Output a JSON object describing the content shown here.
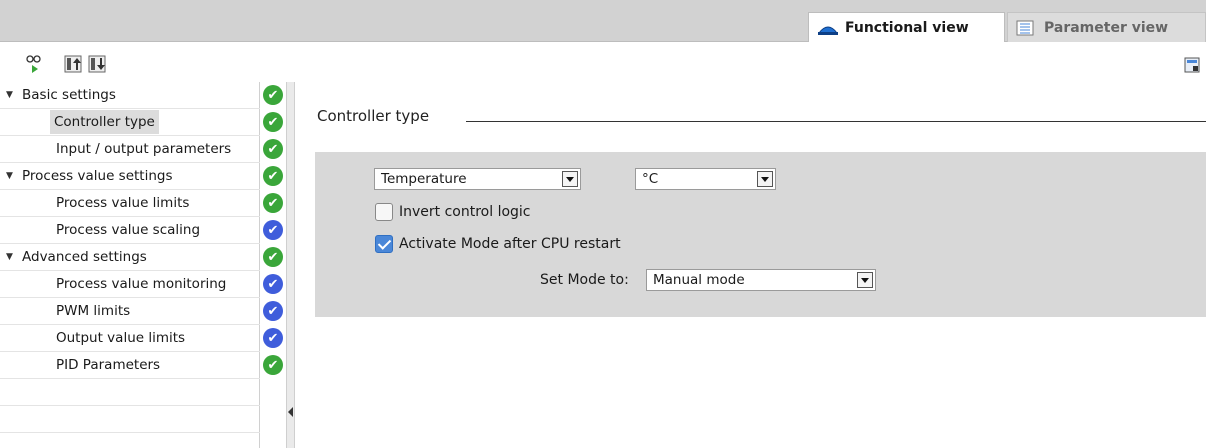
{
  "tabs": {
    "functional_view": "Functional view",
    "parameter_view": "Parameter view"
  },
  "toolbar": {
    "icons": [
      "browse-icon",
      "collapse-icon",
      "expand-icon",
      "panel-layout-icon"
    ]
  },
  "tree": {
    "items": [
      {
        "label": "Basic settings",
        "group": true,
        "status": "ok"
      },
      {
        "label": "Controller type",
        "group": false,
        "status": "ok",
        "selected": true
      },
      {
        "label": "Input / output parameters",
        "group": false,
        "status": "ok"
      },
      {
        "label": "Process value settings",
        "group": true,
        "status": "ok"
      },
      {
        "label": "Process value limits",
        "group": false,
        "status": "ok"
      },
      {
        "label": "Process value scaling",
        "group": false,
        "status": "default"
      },
      {
        "label": "Advanced settings",
        "group": true,
        "status": "ok"
      },
      {
        "label": "Process value monitoring",
        "group": false,
        "status": "default"
      },
      {
        "label": "PWM limits",
        "group": false,
        "status": "default"
      },
      {
        "label": "Output value limits",
        "group": false,
        "status": "default"
      },
      {
        "label": "PID Parameters",
        "group": false,
        "status": "ok"
      }
    ]
  },
  "content": {
    "section_title": "Controller type",
    "controller_type": "Temperature",
    "unit": "°C",
    "invert_control_logic": {
      "label": "Invert control logic",
      "checked": false
    },
    "activate_mode": {
      "label": "Activate Mode after CPU restart",
      "checked": true
    },
    "set_mode_label": "Set Mode to:",
    "set_mode_value": "Manual mode"
  },
  "colors": {
    "status_ok": "#3aa63a",
    "status_default": "#3f5ddb",
    "panel_bg": "#d8d8d8",
    "accent": "#4a87d8"
  }
}
